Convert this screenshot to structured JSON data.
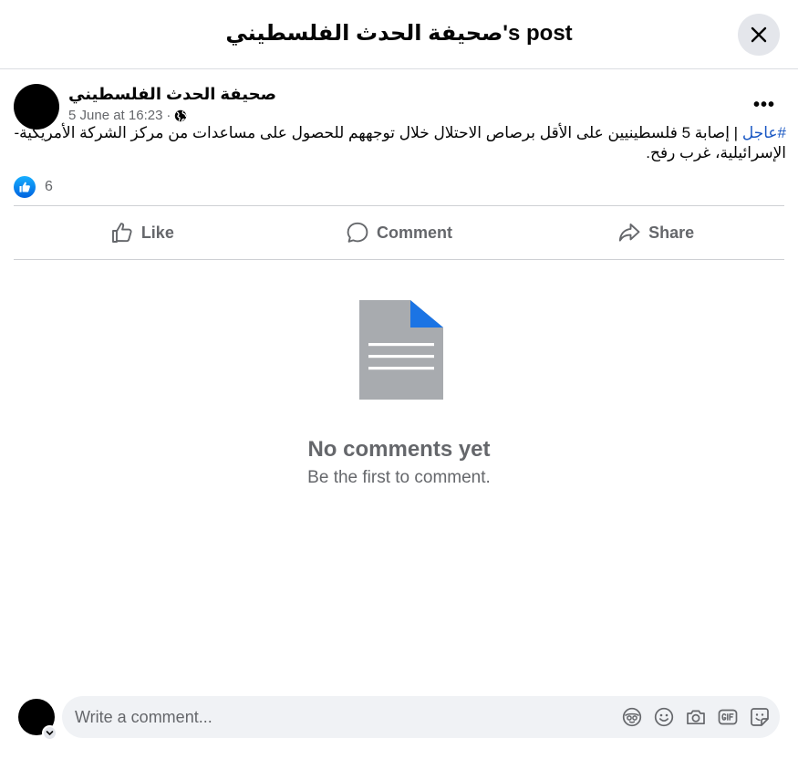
{
  "header": {
    "title": "صحيفة الحدث الفلسطيني's post",
    "close_icon": "close-icon"
  },
  "post": {
    "page_name": "صحيفة الحدث الفلسطيني",
    "timestamp": "5 June at 16:23",
    "separator": "·",
    "audience_icon": "globe-icon",
    "more_label": "•••",
    "hashtag": "#عاجل",
    "text": " | إصابة 5 فلسطينيين على الأقل برصاص الاحتلال خلال توجههم للحصول على مساعدات من مركز الشركة الأمريكية- الإسرائيلية، غرب رفح.",
    "reaction_count": "6"
  },
  "actions": {
    "like": "Like",
    "comment": "Comment",
    "share": "Share"
  },
  "empty_state": {
    "title": "No comments yet",
    "subtitle": "Be the first to comment."
  },
  "composer": {
    "placeholder": "Write a comment...",
    "icons": [
      "avatar-sticker-icon",
      "emoji-icon",
      "camera-icon",
      "gif-icon",
      "sticker-icon"
    ]
  },
  "colors": {
    "accent": "#1877f2",
    "hashtag": "#1a58c4",
    "secondary_text": "#65676b",
    "divider": "#ced0d4",
    "input_bg": "#f0f2f5"
  }
}
